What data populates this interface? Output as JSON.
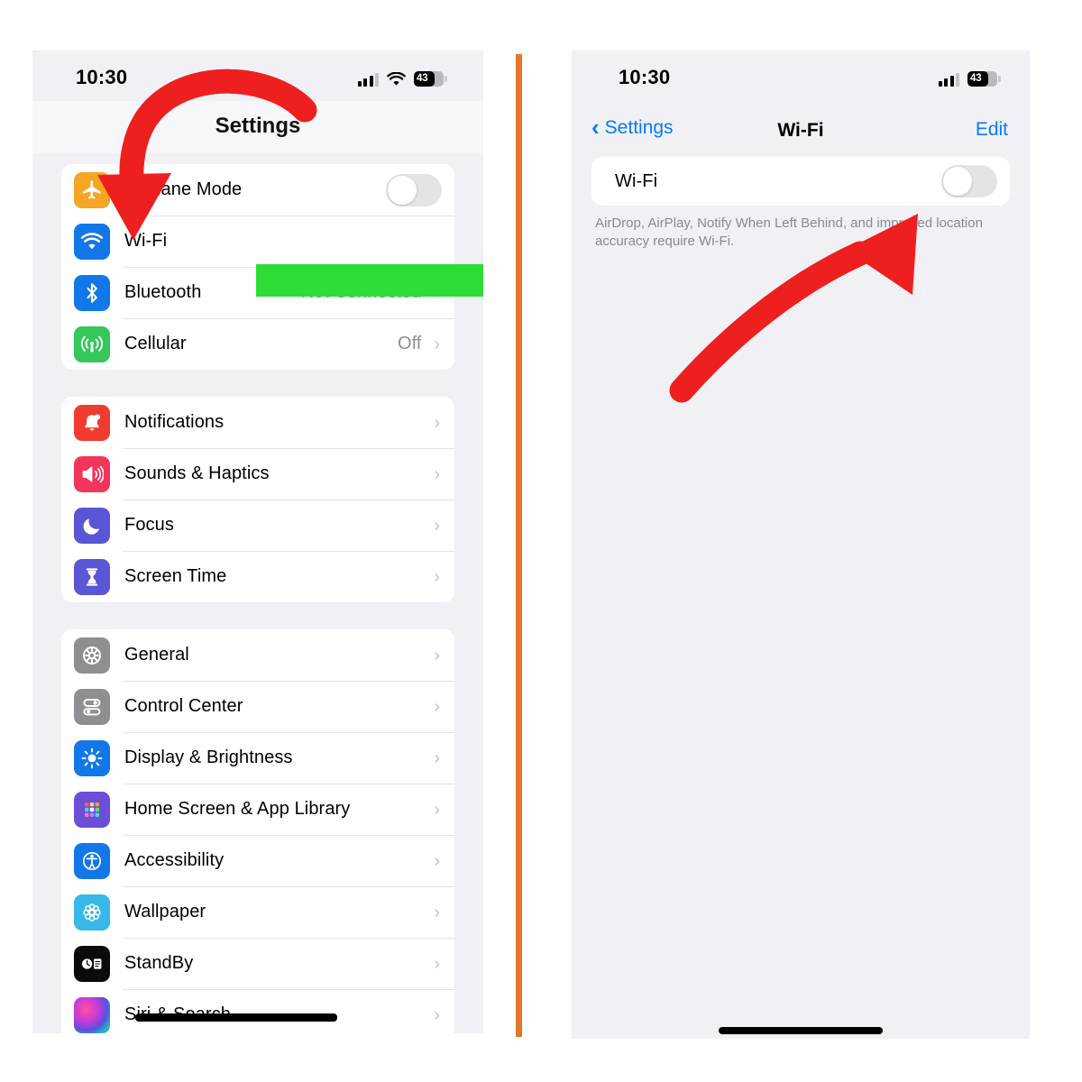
{
  "accent": {
    "ios_blue": "#067bf6",
    "divider_orange": "#e3762a",
    "redaction_green": "#2ddd36",
    "arrow_red": "#ee1f1f"
  },
  "left_phone": {
    "status": {
      "time": "10:30",
      "battery": "43",
      "icons": [
        "cellular-icon",
        "wifi-icon",
        "battery-icon"
      ]
    },
    "nav": {
      "title": "Settings"
    },
    "groups": [
      {
        "rows": [
          {
            "label": "Airplane Mode",
            "icon": "airplane-icon",
            "control": "toggle",
            "toggle_on": false
          },
          {
            "label": "Wi-Fi",
            "icon": "wifi-icon",
            "control": "redacted",
            "value": ""
          },
          {
            "label": "Bluetooth",
            "icon": "bluetooth-icon",
            "control": "chevron",
            "value": "Not Connected"
          },
          {
            "label": "Cellular",
            "icon": "cellular-antenna-icon",
            "control": "chevron",
            "value": "Off"
          }
        ]
      },
      {
        "rows": [
          {
            "label": "Notifications",
            "icon": "bell-icon",
            "control": "chevron",
            "value": ""
          },
          {
            "label": "Sounds & Haptics",
            "icon": "speaker-icon",
            "control": "chevron",
            "value": ""
          },
          {
            "label": "Focus",
            "icon": "moon-icon",
            "control": "chevron",
            "value": ""
          },
          {
            "label": "Screen Time",
            "icon": "hourglass-icon",
            "control": "chevron",
            "value": ""
          }
        ]
      },
      {
        "rows": [
          {
            "label": "General",
            "icon": "gear-icon",
            "control": "chevron",
            "value": ""
          },
          {
            "label": "Control Center",
            "icon": "sliders-icon",
            "control": "chevron",
            "value": ""
          },
          {
            "label": "Display & Brightness",
            "icon": "brightness-icon",
            "control": "chevron",
            "value": ""
          },
          {
            "label": "Home Screen & App Library",
            "icon": "grid-icon",
            "control": "chevron",
            "value": ""
          },
          {
            "label": "Accessibility",
            "icon": "accessibility-icon",
            "control": "chevron",
            "value": ""
          },
          {
            "label": "Wallpaper",
            "icon": "flower-icon",
            "control": "chevron",
            "value": ""
          },
          {
            "label": "StandBy",
            "icon": "standby-icon",
            "control": "chevron",
            "value": ""
          },
          {
            "label": "Siri & Search",
            "icon": "siri-icon",
            "control": "chevron",
            "value": ""
          }
        ]
      }
    ]
  },
  "right_phone": {
    "status": {
      "time": "10:30",
      "battery": "43",
      "icons": [
        "cellular-icon",
        "battery-icon"
      ]
    },
    "nav": {
      "back_label": "Settings",
      "title": "Wi-Fi",
      "edit_label": "Edit"
    },
    "wifi_row": {
      "label": "Wi-Fi",
      "toggle_on": false
    },
    "footnote": "AirDrop, AirPlay, Notify When Left Behind, and improved location accuracy require Wi-Fi."
  },
  "annotations": {
    "left_arrow": "curved-arrow-pointing-down-to-wifi-row",
    "right_arrow": "curved-arrow-pointing-up-right-to-wifi-toggle"
  }
}
